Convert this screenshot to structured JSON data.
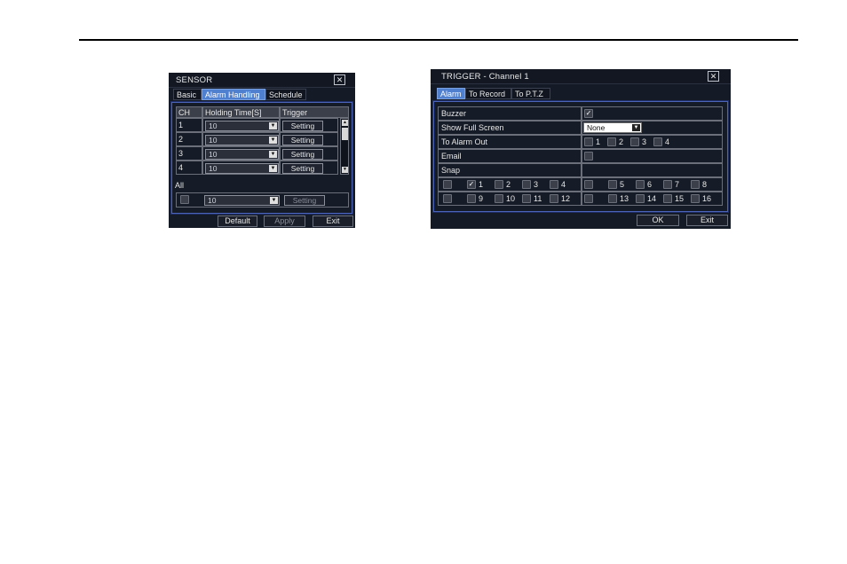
{
  "sensor": {
    "title": "SENSOR",
    "tabs": [
      "Basic",
      "Alarm Handling",
      "Schedule"
    ],
    "headers": {
      "ch": "CH",
      "holding": "Holding Time[S]",
      "trigger": "Trigger"
    },
    "rows": [
      {
        "ch": "1",
        "holding": "10",
        "trigger": "Setting"
      },
      {
        "ch": "2",
        "holding": "10",
        "trigger": "Setting"
      },
      {
        "ch": "3",
        "holding": "10",
        "trigger": "Setting"
      },
      {
        "ch": "4",
        "holding": "10",
        "trigger": "Setting"
      }
    ],
    "all_label": "All",
    "all_holding": "10",
    "all_trigger": "Setting",
    "buttons": {
      "default": "Default",
      "apply": "Apply",
      "exit": "Exit"
    }
  },
  "trigger": {
    "title": "TRIGGER - Channel 1",
    "tabs": [
      "Alarm",
      "To Record",
      "To P.T.Z"
    ],
    "labels": {
      "buzzer": "Buzzer",
      "fullscreen": "Show Full Screen",
      "alarm_out": "To Alarm Out",
      "email": "Email",
      "snap": "Snap"
    },
    "fullscreen_value": "None",
    "alarm_out_items": [
      "1",
      "2",
      "3",
      "4"
    ],
    "snap_row1": [
      "1",
      "2",
      "3",
      "4",
      "5",
      "6",
      "7",
      "8"
    ],
    "snap_row2": [
      "9",
      "10",
      "11",
      "12",
      "13",
      "14",
      "15",
      "16"
    ],
    "buttons": {
      "ok": "OK",
      "exit": "Exit"
    }
  }
}
